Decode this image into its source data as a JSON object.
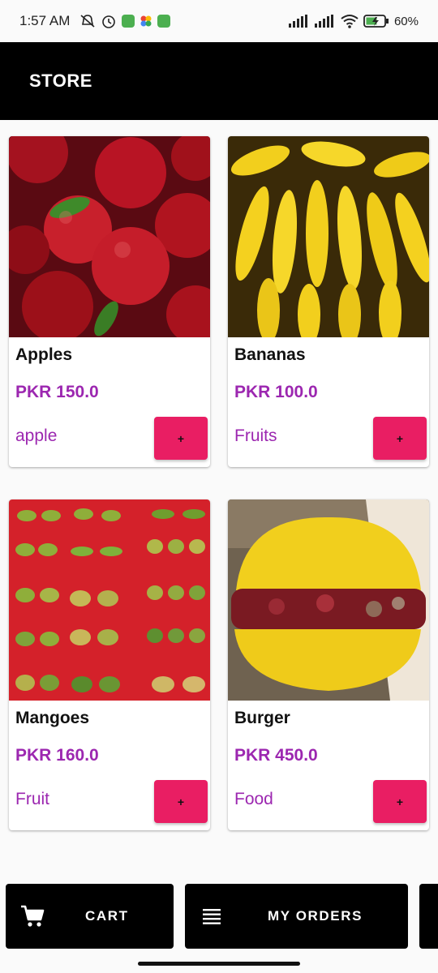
{
  "status": {
    "time": "1:57 AM",
    "battery": "60%"
  },
  "appbar": {
    "title": "STORE"
  },
  "products": [
    {
      "name": "Apples",
      "price": "PKR 150.0",
      "category": "apple",
      "add_label": "+"
    },
    {
      "name": "Bananas",
      "price": "PKR 100.0",
      "category": "Fruits",
      "add_label": "+"
    },
    {
      "name": "Mangoes",
      "price": "PKR 160.0",
      "category": "Fruit",
      "add_label": "+"
    },
    {
      "name": "Burger",
      "price": "PKR 450.0",
      "category": "Food",
      "add_label": "+"
    }
  ],
  "bottom_nav": {
    "cart_label": "CART",
    "orders_label": "MY ORDERS"
  },
  "colors": {
    "appbar": "#000000",
    "accent_purple": "#9c27b0",
    "add_button": "#e91e63"
  }
}
